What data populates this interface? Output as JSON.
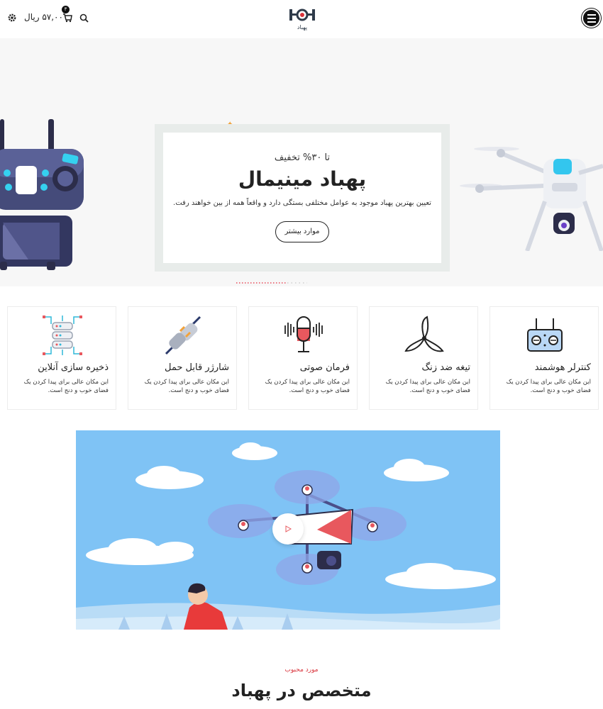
{
  "header": {
    "cart_total": "۵۷,۰۰۰ ریال",
    "cart_count": "۳",
    "logo_text": "پهباد",
    "icons": [
      "menu-icon",
      "settings-icon",
      "cart-icon",
      "search-icon"
    ]
  },
  "hero": {
    "discount": "تا ۳۰% تخفیف",
    "title": "پهباد مینیمال",
    "description": "تعیین بهترین پهباد موجود به عوامل مختلفی بستگی دارد و واقعاً همه از بین خواهند رفت.",
    "button_label": "موارد بیشتر"
  },
  "features": [
    {
      "title": "کنترلر هوشمند",
      "description": "این مکان عالی برای پیدا کردن یک فضای خوب و دنج است.",
      "icon": "controller-icon"
    },
    {
      "title": "تیغه ضد زنگ",
      "description": "این مکان عالی برای پیدا کردن یک فضای خوب و دنج است.",
      "icon": "blade-icon"
    },
    {
      "title": "فرمان صوتی",
      "description": "این مکان عالی برای پیدا کردن یک فضای خوب و دنج است.",
      "icon": "microphone-icon"
    },
    {
      "title": "شارژر قابل حمل",
      "description": "این مکان عالی برای پیدا کردن یک فضای خوب و دنج است.",
      "icon": "plug-icon"
    },
    {
      "title": "ذخیره سازی آنلاین",
      "description": "این مکان عالی برای پیدا کردن یک فضای خوب و دنج است.",
      "icon": "database-icon"
    }
  ],
  "section": {
    "subtitle": "مورد محبوب",
    "title": "متخصص در پهباد"
  },
  "colors": {
    "accent": "#d9323a",
    "sky": "#7fc3f5",
    "hero_frame": "#e8ecea"
  }
}
